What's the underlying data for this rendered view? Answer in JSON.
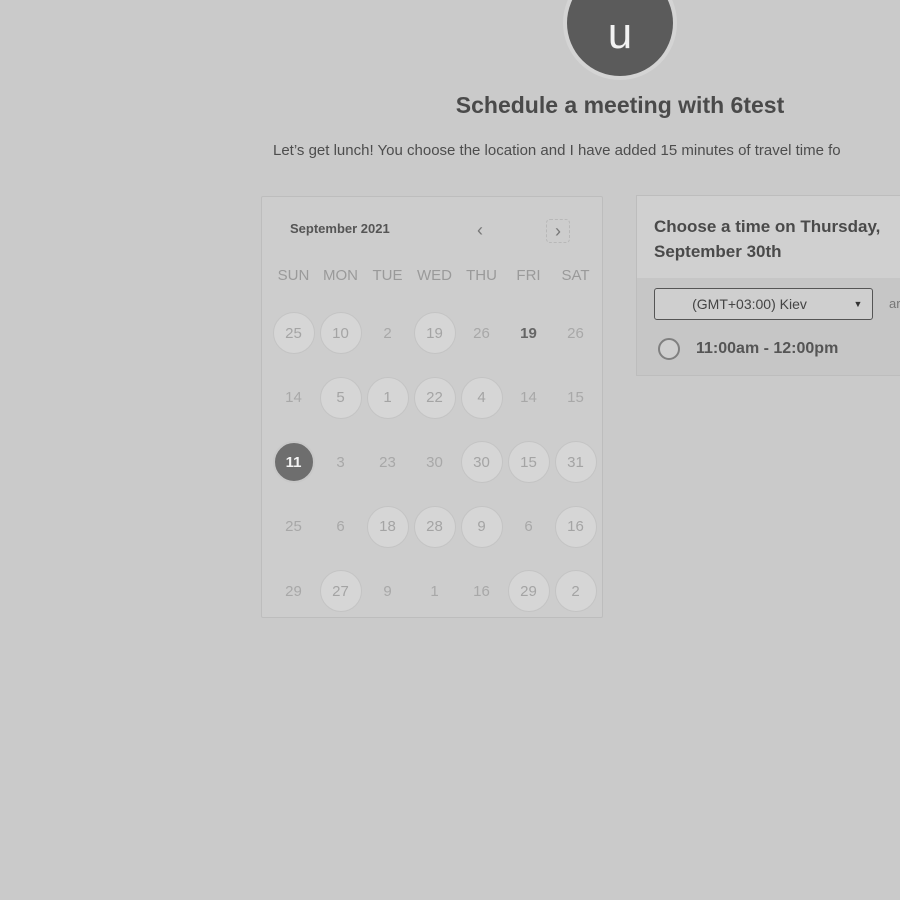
{
  "avatar": {
    "initial": "u"
  },
  "header": {
    "title": "Schedule a meeting with 6test",
    "subtitle": "Let’s get lunch! You choose the location and I have added 15 minutes of travel time fo"
  },
  "calendar": {
    "month_label": "September 2021",
    "prev_icon": "‹",
    "next_icon": "›",
    "weekdays": [
      "SUN",
      "MON",
      "TUE",
      "WED",
      "THU",
      "FRI",
      "SAT"
    ],
    "days": [
      {
        "label": "25",
        "state": "avail"
      },
      {
        "label": "10",
        "state": "avail"
      },
      {
        "label": "2",
        "state": "plain"
      },
      {
        "label": "19",
        "state": "avail"
      },
      {
        "label": "26",
        "state": "plain"
      },
      {
        "label": "19",
        "state": "bold"
      },
      {
        "label": "26",
        "state": "plain"
      },
      {
        "label": "14",
        "state": "plain"
      },
      {
        "label": "5",
        "state": "avail"
      },
      {
        "label": "1",
        "state": "avail"
      },
      {
        "label": "22",
        "state": "avail"
      },
      {
        "label": "4",
        "state": "avail"
      },
      {
        "label": "14",
        "state": "plain"
      },
      {
        "label": "15",
        "state": "plain"
      },
      {
        "label": "11",
        "state": "selected"
      },
      {
        "label": "3",
        "state": "plain"
      },
      {
        "label": "23",
        "state": "plain"
      },
      {
        "label": "30",
        "state": "plain"
      },
      {
        "label": "30",
        "state": "avail"
      },
      {
        "label": "15",
        "state": "avail"
      },
      {
        "label": "31",
        "state": "avail"
      },
      {
        "label": "25",
        "state": "plain"
      },
      {
        "label": "6",
        "state": "plain"
      },
      {
        "label": "18",
        "state": "avail"
      },
      {
        "label": "28",
        "state": "avail"
      },
      {
        "label": "9",
        "state": "avail"
      },
      {
        "label": "6",
        "state": "plain"
      },
      {
        "label": "16",
        "state": "avail"
      },
      {
        "label": "29",
        "state": "plain"
      },
      {
        "label": "27",
        "state": "avail"
      },
      {
        "label": "9",
        "state": "plain"
      },
      {
        "label": "1",
        "state": "plain"
      },
      {
        "label": "16",
        "state": "plain"
      },
      {
        "label": "29",
        "state": "avail"
      },
      {
        "label": "2",
        "state": "avail"
      }
    ]
  },
  "time_panel": {
    "title": "Choose a time on Thursday, September 30th",
    "timezone": "(GMT+03:00) Kiev",
    "extra": "ar",
    "slots": [
      {
        "label": "11:00am - 12:00pm"
      }
    ]
  }
}
